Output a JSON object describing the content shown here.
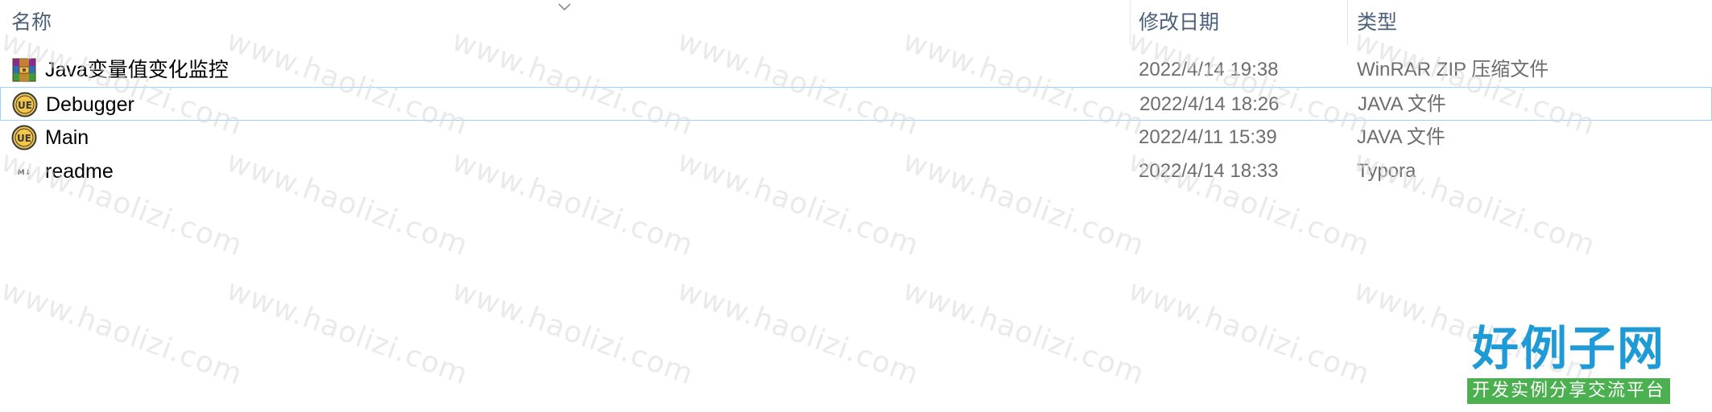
{
  "header": {
    "name": "名称",
    "date": "修改日期",
    "type": "类型",
    "sort_icon": "chevron-down-icon"
  },
  "files": [
    {
      "name": "Java变量值变化监控",
      "date": "2022/4/14 19:38",
      "type": "WinRAR ZIP 压缩文件",
      "icon": "winrar-zip-icon"
    },
    {
      "name": "Debugger",
      "date": "2022/4/14 18:26",
      "type": "JAVA 文件",
      "icon": "ultraedit-icon"
    },
    {
      "name": "Main",
      "date": "2022/4/11 15:39",
      "type": "JAVA 文件",
      "icon": "ultraedit-icon"
    },
    {
      "name": "readme",
      "date": "2022/4/14 18:33",
      "type": "Typora",
      "icon": "markdown-icon"
    }
  ],
  "watermark": {
    "text": "www.haolizi.com"
  },
  "logo": {
    "title": "好例子网",
    "subtitle": "开发实例分享交流平台"
  },
  "colors": {
    "header_text": "#4c607a",
    "secondary_text": "#6d6d6d",
    "focus_border": "#99d1ff",
    "logo_blue": "#1e9bd7",
    "logo_green": "#4cb050"
  }
}
